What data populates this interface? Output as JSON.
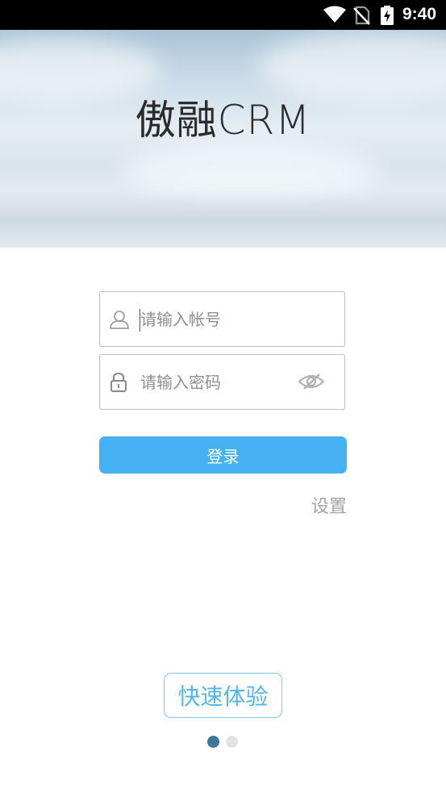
{
  "status_bar": {
    "time": "9:40",
    "icons": [
      "wifi-icon",
      "no-sim-icon",
      "battery-charging-icon"
    ]
  },
  "banner": {
    "logo_cn": "傲融",
    "logo_en": "CRM"
  },
  "login_form": {
    "username_placeholder": "请输入帐号",
    "username_value": "",
    "password_placeholder": "请输入密码",
    "password_value": "",
    "login_label": "登录",
    "settings_label": "设置",
    "icons": [
      "user-icon",
      "lock-icon",
      "eye-hidden-icon"
    ]
  },
  "quick_experience_label": "快速体验",
  "pager": {
    "count": 2,
    "active": 1
  },
  "colors": {
    "primary": "#45b1f2",
    "quick_border": "#7ec8ee",
    "quick_text": "#53b6ea",
    "muted_text": "#a3a3a3",
    "dot_active": "#3a7896",
    "dot_inactive": "#e3e3e3"
  }
}
